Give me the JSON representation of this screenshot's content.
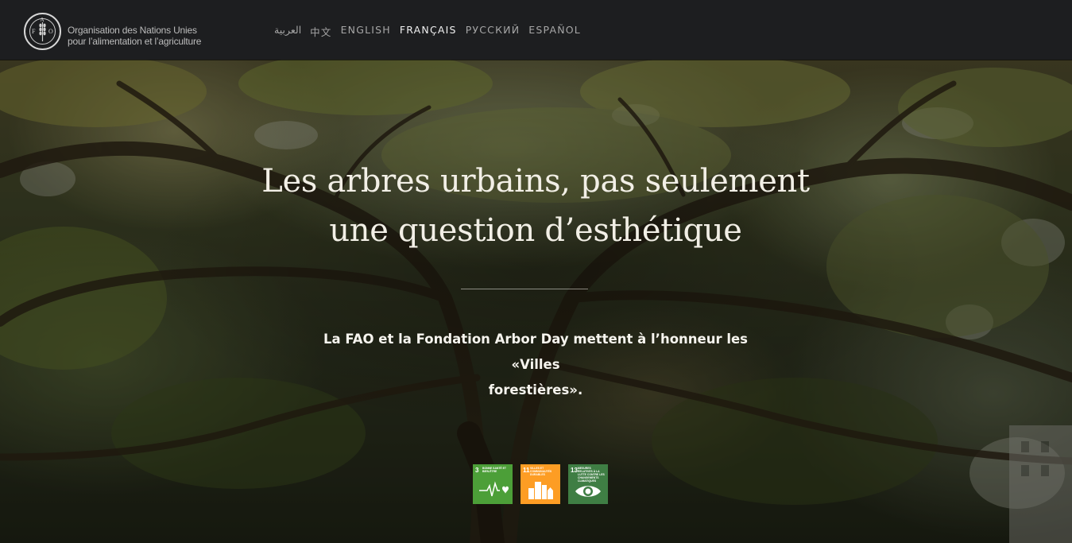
{
  "header": {
    "org_line1": "Organisation des Nations Unies",
    "org_line2": "pour l’alimentation et l’agriculture",
    "logo_text": "FAO",
    "languages": [
      {
        "label": "العربية",
        "active": false
      },
      {
        "label": "中文",
        "active": false
      },
      {
        "label": "ENGLISH",
        "active": false
      },
      {
        "label": "FRANÇAIS",
        "active": true
      },
      {
        "label": "РУССКИЙ",
        "active": false
      },
      {
        "label": "ESPAÑOL",
        "active": false
      }
    ]
  },
  "hero": {
    "title_line1": "Les arbres urbains, pas seulement",
    "title_line2": "une question d’esthétique",
    "subtitle_line1": "La FAO et la Fondation Arbor Day mettent à l’honneur les «Villes",
    "subtitle_line2": "forestières».",
    "background": "tree-canopy-photo"
  },
  "sdgs": [
    {
      "number": "3",
      "label": "Bonne santé et bien-être",
      "color": "#4c9f38",
      "icon": "heartbeat-icon"
    },
    {
      "number": "11",
      "label": "Villes et communautés durables",
      "color": "#fd9d24",
      "icon": "city-icon"
    },
    {
      "number": "13",
      "label": "Mesures relatives à la lutte contre les changements climatiques",
      "color": "#3f7e44",
      "icon": "eye-globe-icon"
    }
  ],
  "colors": {
    "header_bg": "#1d1e20",
    "lang_inactive": "#a6a6a6",
    "lang_active": "#f0f0f0"
  }
}
